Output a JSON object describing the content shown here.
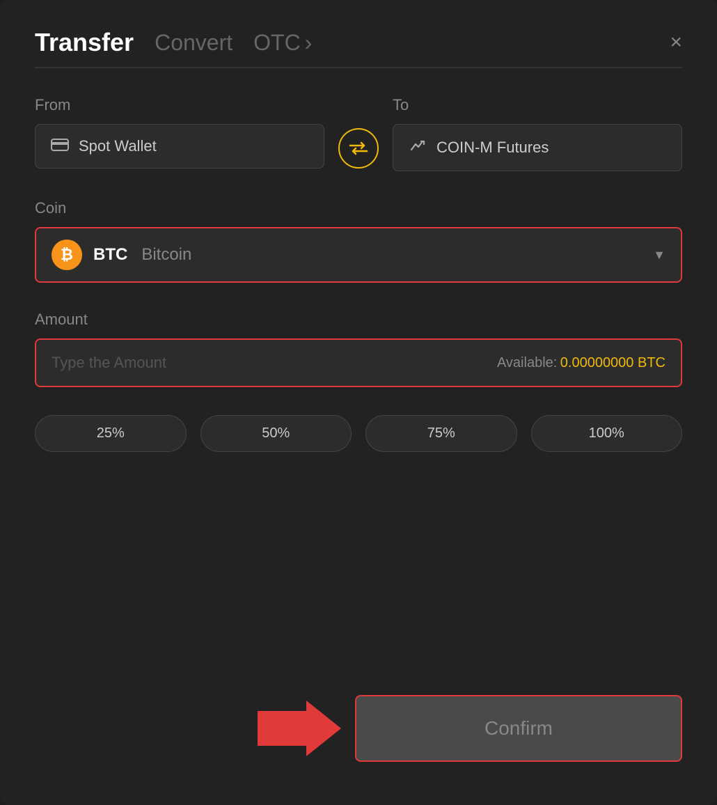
{
  "header": {
    "tab_transfer": "Transfer",
    "tab_convert": "Convert",
    "tab_otc": "OTC",
    "otc_arrow": "›",
    "close_label": "×"
  },
  "from_section": {
    "label": "From",
    "wallet_name": "Spot Wallet"
  },
  "to_section": {
    "label": "To",
    "wallet_name": "COIN-M Futures"
  },
  "coin_section": {
    "label": "Coin",
    "coin_symbol": "BTC",
    "coin_name": "Bitcoin"
  },
  "amount_section": {
    "label": "Amount",
    "placeholder": "Type the Amount",
    "available_label": "Available:",
    "available_value": "0.00000000 BTC"
  },
  "percentage_buttons": [
    "25%",
    "50%",
    "75%",
    "100%"
  ],
  "confirm_button": {
    "label": "Confirm"
  }
}
